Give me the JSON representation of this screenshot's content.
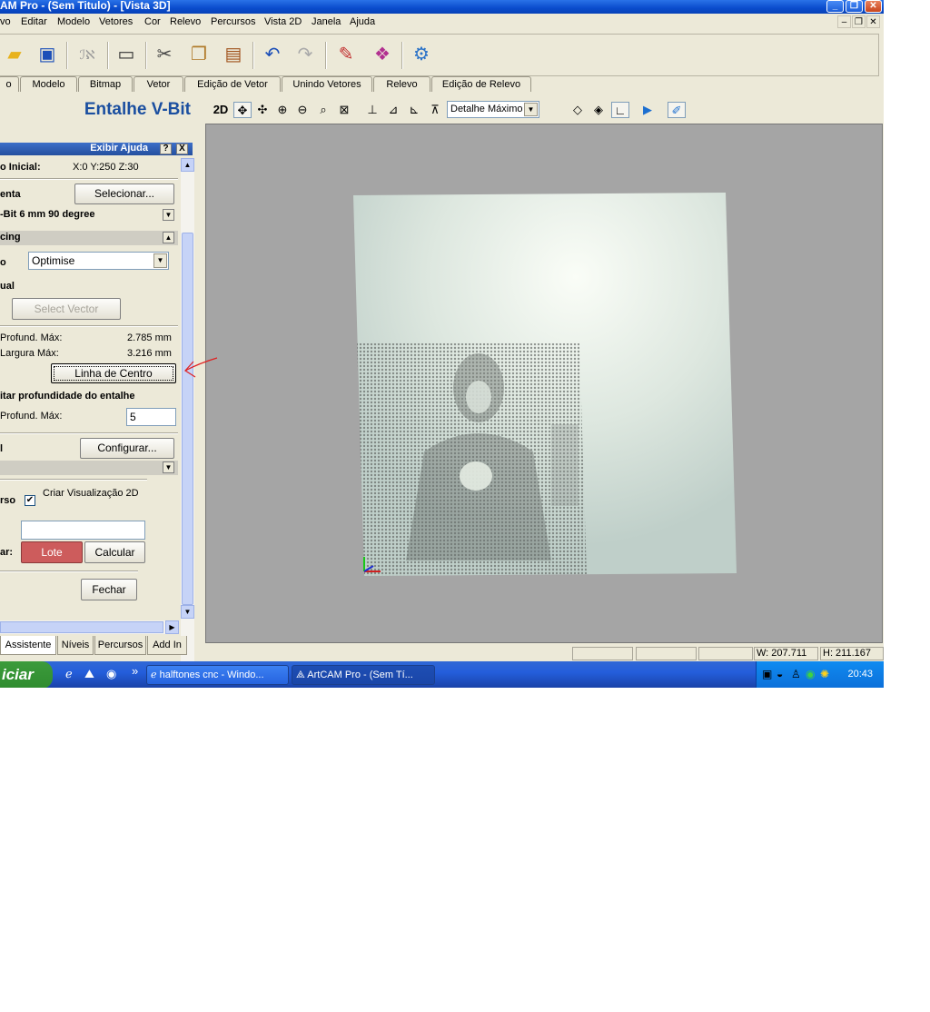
{
  "window": {
    "title": "AM Pro - (Sem Titulo) - [Vista 3D]"
  },
  "menu": [
    "vo",
    "Editar",
    "Modelo",
    "Vetores",
    "Cor",
    "Relevo",
    "Percursos",
    "Vista 2D",
    "Janela",
    "Ajuda"
  ],
  "toolbar_icons": [
    "open-folder",
    "save",
    "trace",
    "select-rect",
    "cut",
    "copy",
    "paste",
    "undo",
    "redo",
    "edit",
    "book",
    "wizard"
  ],
  "tabs": [
    "o",
    "Modelo",
    "Bitmap",
    "Vetor",
    "Edição de Vetor",
    "Unindo Vetores",
    "Relevo",
    "Edição de Relevo"
  ],
  "panel": {
    "title": "Entalhe V-Bit",
    "help": "Exibir Ajuda",
    "help_q": "?",
    "help_x": "X",
    "start_point_label": "o Inicial:",
    "start_point_value": "X:0 Y:250 Z:30",
    "tool_label": "enta",
    "tool_select": "Selecionar...",
    "tool_name": "-Bit 6 mm 90 degree",
    "spacing_section": "cing",
    "spacing_label": "o",
    "spacing_value": "Optimise",
    "manual_label": "ual",
    "select_vector": "Select Vector",
    "max_depth_label": "Profund. Máx:",
    "max_depth_value": "2.785 mm",
    "max_width_label": "Largura Máx:",
    "max_width_value": "3.216 mm",
    "centerline_button": "Linha de Centro",
    "limit_depth_label": "itar profundidade do entalhe",
    "limit_max_label": "Profund. Máx:",
    "limit_max_value": "5",
    "material_label": "l",
    "configure_button": "Configurar...",
    "path_label": "rso",
    "create_preview": "Criar Visualização 2D",
    "path_name": "",
    "calc_label": "ar:",
    "batch_button": "Lote",
    "calc_button": "Calcular",
    "close_button": "Fechar",
    "bottom_tabs": [
      "Assistente",
      "Níveis",
      "Percursos",
      "Add In"
    ]
  },
  "view_toolbar": {
    "mode": "2D",
    "detail": "Detalhe Máximo"
  },
  "status": {
    "width": "W: 207.711",
    "height": "H: 211.167"
  },
  "taskbar": {
    "start": "iciar",
    "quick_more": "»",
    "tasks": [
      "halftones cnc - Windo...",
      "ArtCAM Pro - (Sem Tí..."
    ],
    "clock": "20:43"
  },
  "colors": {
    "titlebar": "#0a4ccc",
    "panel_title": "#1b4fa0",
    "batch_button": "#cd5c5c",
    "viewport_bg": "#a5a5a5",
    "annotation_arrow": "#e02020"
  }
}
